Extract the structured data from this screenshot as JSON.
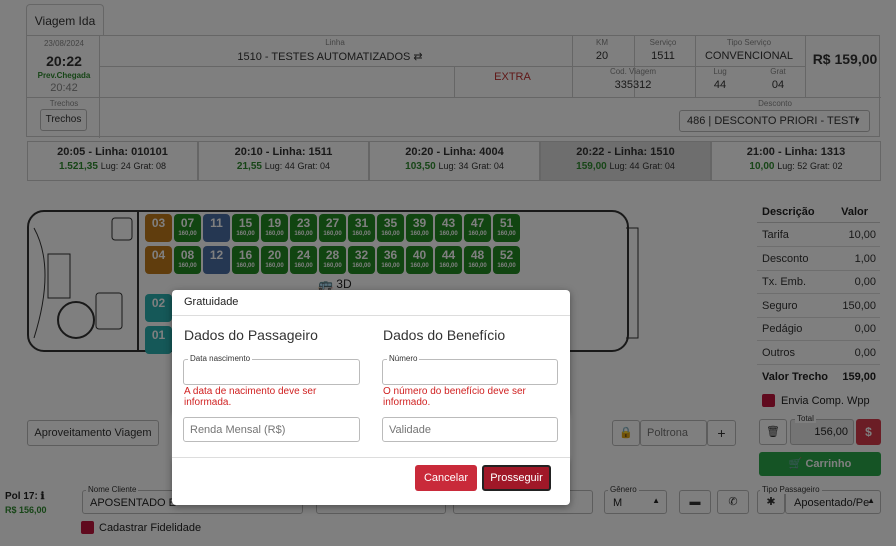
{
  "tab": {
    "label": "Viagem Ida"
  },
  "header": {
    "date": "23/08/2024",
    "time": "20:22",
    "prev_label": "Prev.Chegada",
    "prev_time": "20:42",
    "linha_label": "Linha",
    "linha": "1510 - TESTES AUTOMATIZADOS",
    "extra": "EXTRA",
    "km_label": "KM",
    "km": "20",
    "servico_label": "Serviço",
    "servico": "1511",
    "tipo_label": "Tipo Serviço",
    "tipo": "CONVENCIONAL",
    "price": "R$ 159,00",
    "cod_label": "Cod. Viagem",
    "cod": "335312",
    "lug_label": "Lug",
    "lug": "44",
    "grat_label": "Grat",
    "grat": "04",
    "trechos_label": "Trechos",
    "trechos_btn": "Trechos",
    "desconto_label": "Desconto",
    "desconto": "486 | DESCONTO PRIORI - TESTI"
  },
  "trips": [
    {
      "title": "20:05 - Linha: 010101",
      "price": "1.521,35",
      "lug": "Lug: 24",
      "grat": "Grat: 08"
    },
    {
      "title": "20:10 - Linha: 1511",
      "price": "21,55",
      "lug": "Lug: 44",
      "grat": "Grat: 04"
    },
    {
      "title": "20:20 - Linha: 4004",
      "price": "103,50",
      "lug": "Lug: 34",
      "grat": "Grat: 04"
    },
    {
      "title": "20:22 - Linha: 1510",
      "price": "159,00",
      "lug": "Lug: 44",
      "grat": "Grat: 04"
    },
    {
      "title": "21:00 - Linha: 1313",
      "price": "10,00",
      "lug": "Lug: 52",
      "grat": "Grat: 02"
    }
  ],
  "seats": {
    "price": "160,00",
    "row1": [
      "07",
      "15",
      "19",
      "23",
      "27",
      "31",
      "35",
      "39",
      "43",
      "47",
      "51"
    ],
    "row2": [
      "08",
      "16",
      "20",
      "24",
      "28",
      "32",
      "36",
      "40",
      "44",
      "48",
      "52"
    ],
    "orange": [
      "03",
      "04"
    ],
    "blue": [
      "11",
      "12"
    ],
    "teal": [
      "02",
      "01"
    ],
    "deck": "3D"
  },
  "summary": {
    "h1": "Descrição",
    "h2": "Valor",
    "rows": [
      [
        "Tarifa",
        "10,00"
      ],
      [
        "Desconto",
        "1,00"
      ],
      [
        "Tx. Emb.",
        "0,00"
      ],
      [
        "Seguro",
        "150,00"
      ],
      [
        "Pedágio",
        "0,00"
      ],
      [
        "Outros",
        "0,00"
      ]
    ],
    "total_label": "Valor Trecho",
    "total": "159,00",
    "wpp": "Envia Comp. Wpp",
    "total_small_label": "Total",
    "total_value": "156,00",
    "currency_btn": "$",
    "carrinho": "Carrinho"
  },
  "aproveitamento": "Aproveitamento Viagem",
  "poltrona_placeholder": "Poltrona",
  "bottom": {
    "pol_label": "Pol 17:",
    "pol_price": "R$ 156,00",
    "nome_label": "Nome Cliente",
    "nome": "APOSENTADO E",
    "genero_label": "Gênero",
    "genero": "M",
    "tipo_pass_label": "Tipo Passageiro",
    "tipo_pass": "Aposentado/Pe",
    "fidelidade": "Cadastrar Fidelidade"
  },
  "modal": {
    "title": "Gratuidade",
    "left_title": "Dados do Passageiro",
    "right_title": "Dados do Benefício",
    "nasc_label": "Data nascimento",
    "num_label": "Número",
    "err_nasc": "A data de nacimento deve ser informada.",
    "err_num": "O número do benefício deve ser informado.",
    "renda_ph": "Renda Mensal (R$)",
    "validade_ph": "Validade",
    "cancel": "Cancelar",
    "ok": "Prosseguir"
  }
}
